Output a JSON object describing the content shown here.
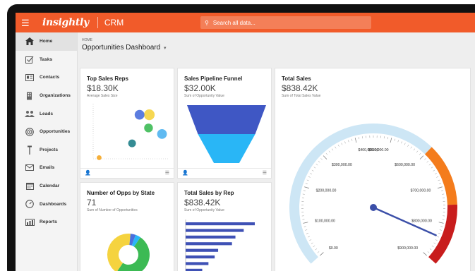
{
  "app": {
    "logo": "insightly",
    "product": "CRM",
    "search_placeholder": "Search all data...",
    "accent": "#f15b2a"
  },
  "sidebar": {
    "items": [
      {
        "label": "Home",
        "icon": "home-icon",
        "active": true
      },
      {
        "label": "Tasks",
        "icon": "checkbox-icon"
      },
      {
        "label": "Contacts",
        "icon": "contact-card-icon"
      },
      {
        "label": "Organizations",
        "icon": "building-icon"
      },
      {
        "label": "Leads",
        "icon": "people-icon"
      },
      {
        "label": "Opportunities",
        "icon": "target-icon"
      },
      {
        "label": "Projects",
        "icon": "pin-icon"
      },
      {
        "label": "Emails",
        "icon": "envelope-icon"
      },
      {
        "label": "Calendar",
        "icon": "calendar-icon"
      },
      {
        "label": "Dashboards",
        "icon": "gauge-icon"
      },
      {
        "label": "Reports",
        "icon": "bar-chart-icon"
      }
    ]
  },
  "header": {
    "breadcrumb": "HOME",
    "title": "Opportunities Dashboard",
    "caret": "▾"
  },
  "cards": {
    "top_sales_reps": {
      "title": "Top Sales Reps",
      "value": "$18.30K",
      "subtitle": "Average Sales Size"
    },
    "pipeline_funnel": {
      "title": "Sales Pipeline Funnel",
      "value": "$32.00K",
      "subtitle": "Sum of Opportunity Value"
    },
    "total_sales": {
      "title": "Total Sales",
      "value": "$838.42K",
      "subtitle": "Sum of Total Sales Value"
    },
    "opps_by_state": {
      "title": "Number of Opps by State",
      "value": "71",
      "subtitle": "Sum of Number of Opportunities"
    },
    "sales_by_rep": {
      "title": "Total Sales by Rep",
      "value": "$838.42K",
      "subtitle": "Sum of Opportunity Value"
    }
  },
  "chart_data": [
    {
      "type": "scatter",
      "points": [
        {
          "x": 0.75,
          "y": 0.8,
          "size": 0.8,
          "color": "#f5d33f"
        },
        {
          "x": 0.62,
          "y": 0.8,
          "size": 0.7,
          "color": "#4a6fdc"
        },
        {
          "x": 0.92,
          "y": 0.45,
          "size": 0.7,
          "color": "#4fb3f0"
        },
        {
          "x": 0.74,
          "y": 0.56,
          "size": 0.6,
          "color": "#3cba54"
        },
        {
          "x": 0.52,
          "y": 0.28,
          "size": 0.5,
          "color": "#1f7f88"
        },
        {
          "x": 0.08,
          "y": 0.02,
          "size": 0.2,
          "color": "#f5a623"
        }
      ],
      "xlim": [
        0,
        1
      ],
      "ylim": [
        0,
        1
      ]
    },
    {
      "type": "funnel",
      "stages": [
        {
          "value": 1.0,
          "color": "#3f57c4"
        },
        {
          "value": 0.7,
          "color": "#29b6f6"
        }
      ]
    },
    {
      "type": "gauge",
      "min": 0,
      "max": 900000,
      "value": 838420,
      "tick_labels": [
        "$0.00",
        "$100,000.00",
        "$200,000.00",
        "$300,000.00",
        "$400,000.00",
        "$500,000.00",
        "$600,000.00",
        "$700,000.00",
        "$800,000.00",
        "$900,000.00"
      ],
      "bands": [
        {
          "from": 0,
          "to": 600000,
          "color": "#cde6f5"
        },
        {
          "from": 600000,
          "to": 750000,
          "color": "#f47c1c"
        },
        {
          "from": 750000,
          "to": 900000,
          "color": "#c81d1d"
        }
      ],
      "needle_color": "#3b4fa8"
    },
    {
      "type": "pie",
      "donut": true,
      "slices": [
        {
          "value": 50,
          "color": "#3cba54"
        },
        {
          "value": 42,
          "color": "#f5d33f"
        },
        {
          "value": 4,
          "color": "#4a6fdc"
        },
        {
          "value": 4,
          "color": "#29b6f6"
        }
      ]
    },
    {
      "type": "bar",
      "orientation": "horizontal",
      "values": [
        100,
        84,
        72,
        67,
        47,
        42,
        33,
        24,
        19
      ],
      "color": "#3f51b5"
    }
  ]
}
